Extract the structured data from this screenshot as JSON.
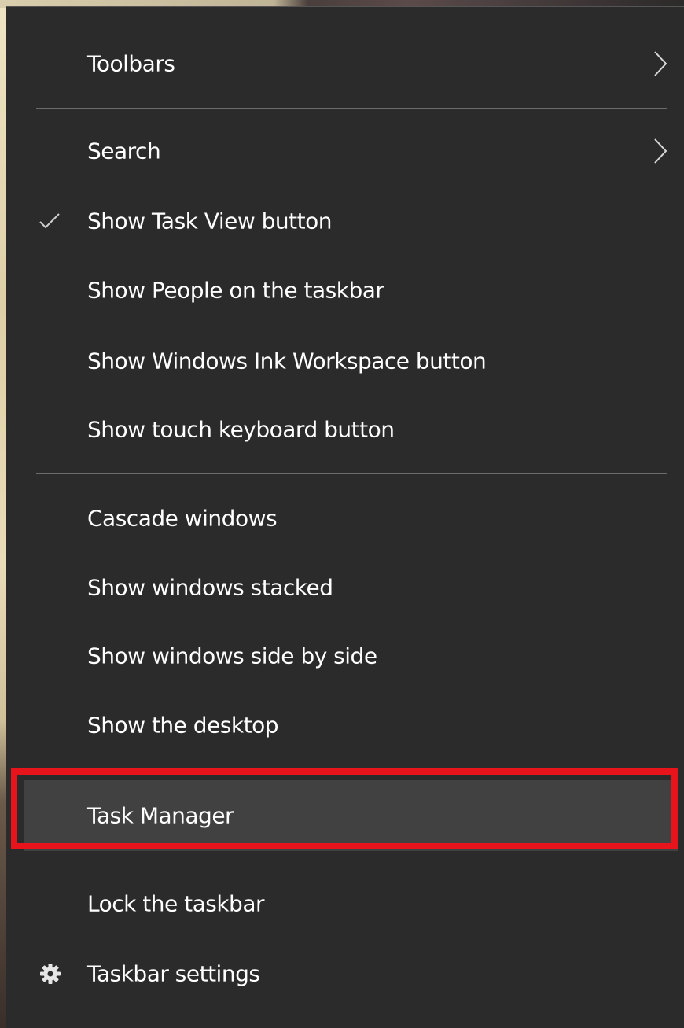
{
  "menu": {
    "items": [
      {
        "label": "Toolbars",
        "submenu": true
      },
      {
        "label": "Search",
        "submenu": true
      },
      {
        "label": "Show Task View button",
        "checked": true
      },
      {
        "label": "Show People on the taskbar"
      },
      {
        "label": "Show Windows Ink Workspace button"
      },
      {
        "label": "Show touch keyboard button"
      },
      {
        "label": "Cascade windows"
      },
      {
        "label": "Show windows stacked"
      },
      {
        "label": "Show windows side by side"
      },
      {
        "label": "Show the desktop"
      },
      {
        "label": "Task Manager",
        "highlighted": true
      },
      {
        "label": "Lock the taskbar"
      },
      {
        "label": "Taskbar settings",
        "icon": "gear-icon"
      }
    ]
  },
  "colors": {
    "menu_bg": "#2b2b2b",
    "highlight_bg": "#414141",
    "annotation_red": "#e8141c",
    "separator": "#6b6b6b",
    "text": "#ffffff"
  }
}
